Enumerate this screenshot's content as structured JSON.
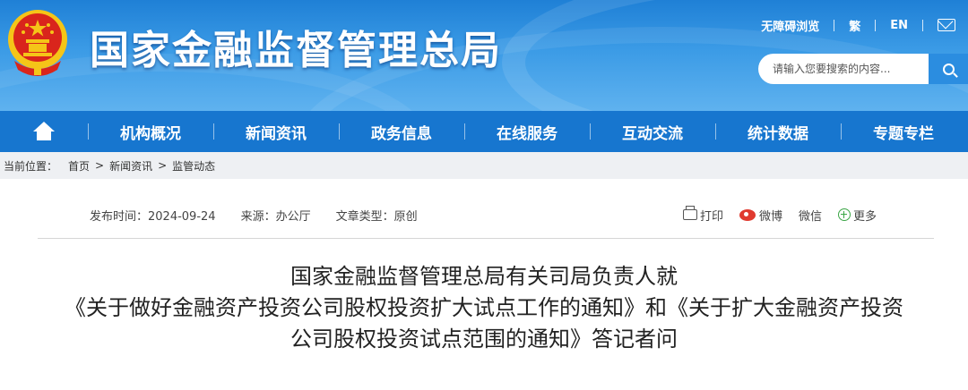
{
  "header": {
    "site_title": "国家金融监督管理总局",
    "top_links": [
      "无障碍浏览",
      "繁",
      "EN"
    ],
    "search_placeholder": "请输入您要搜索的内容..."
  },
  "nav": {
    "items": [
      "机构概况",
      "新闻资讯",
      "政务信息",
      "在线服务",
      "互动交流",
      "统计数据",
      "专题专栏"
    ]
  },
  "breadcrumb": {
    "label": "当前位置：",
    "items": [
      "首页",
      "新闻资讯",
      "监管动态"
    ],
    "separator": ">"
  },
  "meta": {
    "publish": "发布时间：2024-09-24",
    "source": "来源：办公厅",
    "type": "文章类型：原创"
  },
  "share": {
    "print": "打印",
    "weibo": "微博",
    "wechat": "微信",
    "more": "更多"
  },
  "article": {
    "title_lines": [
      "国家金融监督管理总局有关司局负责人就",
      "《关于做好金融资产投资公司股权投资扩大试点工作的通知》和《关于扩大金融资产投资",
      "公司股权投资试点范围的通知》答记者问"
    ]
  },
  "colors": {
    "header_blue": "#1f80d6",
    "nav_blue": "#1776cf",
    "emblem_red": "#d9251c",
    "emblem_gold": "#f5c518"
  },
  "icons": [
    "emblem",
    "mail-icon",
    "search-icon",
    "home-icon",
    "print-icon",
    "weibo-icon",
    "plus-circle-icon"
  ]
}
